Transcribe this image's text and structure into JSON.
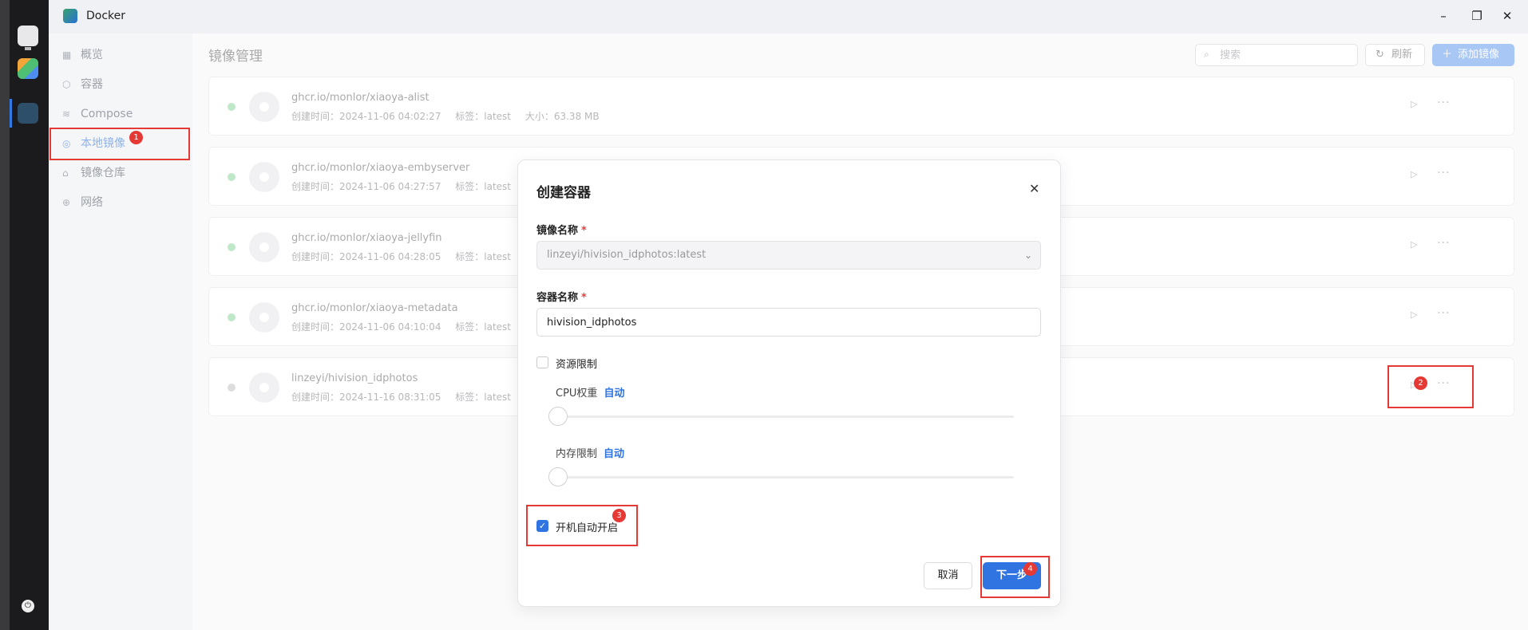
{
  "window": {
    "title": "Docker"
  },
  "sidebar": {
    "items": [
      {
        "label": "概览",
        "icon": "grid-icon"
      },
      {
        "label": "容器",
        "icon": "cube-icon"
      },
      {
        "label": "Compose",
        "icon": "layers-icon"
      },
      {
        "label": "本地镜像",
        "icon": "disc-icon",
        "active": true
      },
      {
        "label": "镜像仓库",
        "icon": "home-icon"
      },
      {
        "label": "网络",
        "icon": "globe-icon"
      }
    ]
  },
  "main": {
    "title": "镜像管理",
    "search_placeholder": "搜索",
    "refresh_label": "刷新",
    "add_label": "添加镜像",
    "images": [
      {
        "name": "ghcr.io/monlor/xiaoya-alist",
        "created": "创建时间：2024-11-06 04:02:27",
        "tag": "标签：latest",
        "size": "大小：63.38 MB",
        "status": "running"
      },
      {
        "name": "ghcr.io/monlor/xiaoya-embyserver",
        "created": "创建时间：2024-11-06 04:27:57",
        "tag": "标签：latest",
        "size": "",
        "status": "running"
      },
      {
        "name": "ghcr.io/monlor/xiaoya-jellyfin",
        "created": "创建时间：2024-11-06 04:28:05",
        "tag": "标签：latest",
        "size": "",
        "status": "running"
      },
      {
        "name": "ghcr.io/monlor/xiaoya-metadata",
        "created": "创建时间：2024-11-06 04:10:04",
        "tag": "标签：latest",
        "size": "",
        "status": "running"
      },
      {
        "name": "linzeyi/hivision_idphotos",
        "created": "创建时间：2024-11-16 08:31:05",
        "tag": "标签：latest",
        "size": "",
        "status": "stopped"
      }
    ]
  },
  "modal": {
    "title": "创建容器",
    "image_label": "镜像名称",
    "image_value": "linzeyi/hivision_idphotos:latest",
    "container_label": "容器名称",
    "container_value": "hivision_idphotos",
    "resource_limit_label": "资源限制",
    "resource_limit_checked": false,
    "cpu_label": "CPU权重",
    "cpu_value": "自动",
    "memory_label": "内存限制",
    "memory_value": "自动",
    "autostart_label": "开机自动开启",
    "autostart_checked": true,
    "cancel_label": "取消",
    "next_label": "下一步"
  },
  "annotations": [
    "1",
    "2",
    "3",
    "4"
  ],
  "colors": {
    "accent": "#2f74e0",
    "annotation": "#e53935",
    "running": "#bfe8c8"
  }
}
